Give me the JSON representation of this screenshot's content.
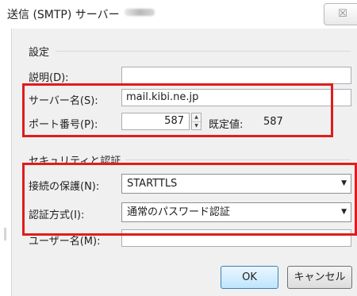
{
  "window": {
    "title": "送信 (SMTP) サーバー",
    "close_glyph": "☒"
  },
  "settings": {
    "section_label": "設定",
    "description_label": "説明(D):",
    "description_value": "",
    "server_label": "サーバー名(S):",
    "server_value": "mail.kibi.ne.jp",
    "port_label": "ポート番号(P):",
    "port_value": "587",
    "default_label": "既定値:",
    "default_value": "587"
  },
  "security": {
    "section_label": "セキュリティと認証",
    "connection_label": "接続の保護(N):",
    "connection_value": "STARTTLS",
    "auth_label": "認証方式(I):",
    "auth_value": "通常のパスワード認証",
    "username_label": "ユーザー名(M):",
    "username_value": ""
  },
  "buttons": {
    "ok": "OK",
    "cancel": "キャンセル"
  },
  "colors": {
    "highlight_box": "#e01c1c",
    "dialog_bg": "#f0f0f0"
  }
}
